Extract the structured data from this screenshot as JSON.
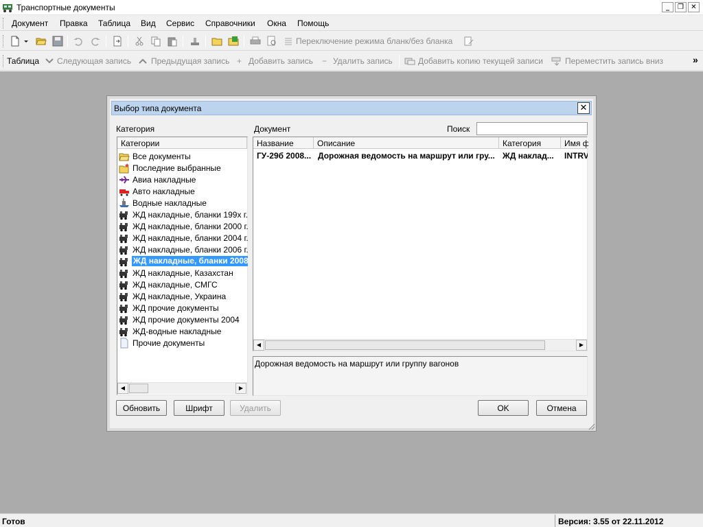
{
  "window": {
    "title": "Транспортные документы",
    "controls": {
      "minimize": "_",
      "maximize": "❐",
      "close": "✕"
    }
  },
  "menu": [
    "Документ",
    "Правка",
    "Таблица",
    "Вид",
    "Сервис",
    "Справочники",
    "Окна",
    "Помощь"
  ],
  "toolbar1": {
    "mode_switch_label": "Переключение режима бланк/без бланка"
  },
  "toolbar2": {
    "table_label": "Таблица",
    "next_label": "Следующая запись",
    "prev_label": "Предыдущая запись",
    "add_label": "Добавить запись",
    "delete_label": "Удалить запись",
    "copy_label": "Добавить копию текущей записи",
    "move_down_label": "Переместить запись вниз",
    "overflow": "»"
  },
  "dialog": {
    "title": "Выбор типа документа",
    "category_label": "Категория",
    "document_label": "Документ",
    "search_label": "Поиск",
    "search_value": "",
    "categories_header": "Категории",
    "categories": [
      {
        "label": "Все документы",
        "icon": "folder-open-icon"
      },
      {
        "label": "Последние выбранные",
        "icon": "folder-star-icon"
      },
      {
        "label": "Авиа накладные",
        "icon": "airplane-icon"
      },
      {
        "label": "Авто накладные",
        "icon": "truck-icon"
      },
      {
        "label": "Водные накладные",
        "icon": "ship-icon"
      },
      {
        "label": "ЖД накладные, бланки 199x г.",
        "icon": "train-icon"
      },
      {
        "label": "ЖД накладные, бланки 2000 г.",
        "icon": "train-icon"
      },
      {
        "label": "ЖД накладные, бланки 2004 г.",
        "icon": "train-icon"
      },
      {
        "label": "ЖД накладные, бланки 2006 г.",
        "icon": "train-icon"
      },
      {
        "label": "ЖД накладные, бланки 2008",
        "icon": "train-icon",
        "selected": true
      },
      {
        "label": "ЖД накладные, Казахстан",
        "icon": "train-icon"
      },
      {
        "label": "ЖД накладные, СМГС",
        "icon": "train-icon"
      },
      {
        "label": "ЖД накладные, Украина",
        "icon": "train-icon"
      },
      {
        "label": "ЖД прочие документы",
        "icon": "train-icon"
      },
      {
        "label": "ЖД прочие документы 2004",
        "icon": "train-icon"
      },
      {
        "label": "ЖД-водные накладные",
        "icon": "train-icon"
      },
      {
        "label": "Прочие документы",
        "icon": "document-icon"
      }
    ],
    "doc_columns": [
      "Название",
      "Описание",
      "Категория",
      "Имя фа"
    ],
    "doc_rows": [
      {
        "name": "ГУ-29б 2008...",
        "description": "Дорожная ведомость на маршрут или гру...",
        "category": "ЖД наклад...",
        "file": "INTRV"
      }
    ],
    "description_text": "Дорожная ведомость на маршрут или группу вагонов",
    "buttons": {
      "refresh": "Обновить",
      "font": "Шрифт",
      "delete": "Удалить",
      "ok": "OK",
      "cancel": "Отмена"
    }
  },
  "status": {
    "left": "Готов",
    "version": "Версия: 3.55 от 22.11.2012"
  }
}
